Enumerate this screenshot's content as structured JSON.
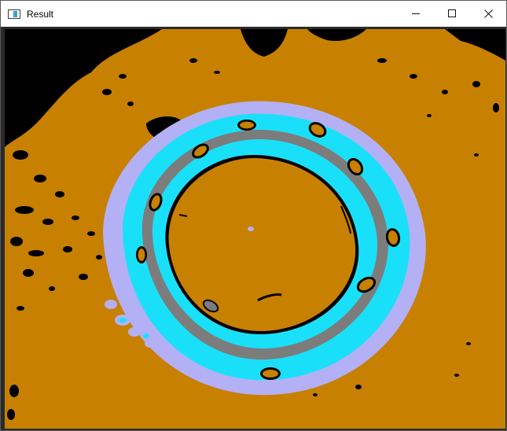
{
  "window": {
    "title": "Result",
    "controls": {
      "minimize": "minimize-icon",
      "maximize": "maximize-icon",
      "close": "close-icon"
    }
  },
  "image": {
    "description_colors": {
      "background": "#c88000",
      "dark": "#000000",
      "cyan": "#19e0f8",
      "lavender": "#b4b0f5",
      "gray": "#7c7c7c"
    }
  }
}
